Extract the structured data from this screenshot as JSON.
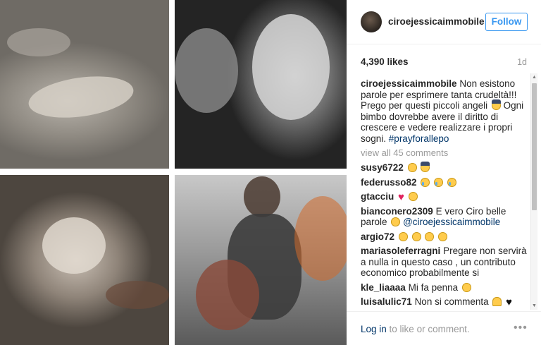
{
  "post": {
    "photo_alt_icon": "photo-collage-icon"
  },
  "header": {
    "username": "ciroejessicaimmobile",
    "follow_label": "Follow"
  },
  "meta": {
    "likes": "4,390 likes",
    "age": "1d"
  },
  "caption": {
    "user": "ciroejessicaimmobile",
    "text": "Non esistono parole per esprimere tanta crudeltà!!! Prego per questi piccoli angeli",
    "text2": "Ogni bimbo dovrebbe avere il diritto di crescere e vedere realizzare i propri sogni.",
    "hashtag": "#prayforallepo"
  },
  "view_all": "view all 45 comments",
  "comments": [
    {
      "user": "susy6722",
      "text": ""
    },
    {
      "user": "federusso82",
      "text": ""
    },
    {
      "user": "gtacciu",
      "text": ""
    },
    {
      "user": "bianconero2309",
      "text": "E vero Ciro belle parole",
      "mention": "@ciroejessicaimmobile"
    },
    {
      "user": "argio72",
      "text": ""
    },
    {
      "user": "mariasoleferragni",
      "text": "Pregare non servirà a nulla in questo caso , un contributo economico probabilmente si"
    },
    {
      "user": "kle_liaaaa",
      "text": "Mi fa penna"
    },
    {
      "user": "luisalulic71",
      "text": "Non si commenta"
    }
  ],
  "footer": {
    "login": "Log in",
    "rest": " to like or comment.",
    "more": "•••"
  },
  "colors": {
    "accent": "#3897f0",
    "link": "#003569",
    "muted": "#999999"
  }
}
